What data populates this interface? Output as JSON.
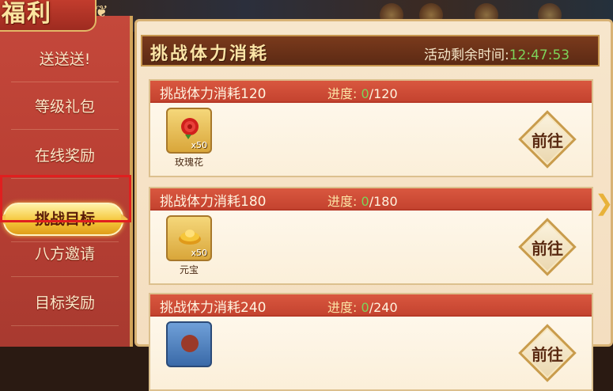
{
  "panel_title": "福利",
  "sidebar": {
    "items": [
      {
        "label": "送送送!"
      },
      {
        "label": "等级礼包"
      },
      {
        "label": "在线奖励"
      },
      {
        "label": "挑战目标",
        "active": true
      },
      {
        "label": "八方邀请"
      },
      {
        "label": "目标奖励"
      }
    ]
  },
  "header": {
    "title": "挑战体力消耗",
    "timer_label": "活动剩余时间:",
    "timer_value": "12:47:53"
  },
  "cards": [
    {
      "title": "挑战体力消耗120",
      "progress_label": "进度:",
      "progress_current": "0",
      "progress_total": "/120",
      "reward_name": "玫瑰花",
      "reward_qty": "x50",
      "reward_icon": "rose-icon",
      "go_label": "前往"
    },
    {
      "title": "挑战体力消耗180",
      "progress_label": "进度:",
      "progress_current": "0",
      "progress_total": "/180",
      "reward_name": "元宝",
      "reward_qty": "x50",
      "reward_icon": "gold-ingot-icon",
      "go_label": "前往"
    },
    {
      "title": "挑战体力消耗240",
      "progress_label": "进度:",
      "progress_current": "0",
      "progress_total": "/240",
      "reward_icon": "item-icon",
      "go_label": "前往"
    }
  ],
  "colors": {
    "sidebar_red": "#c4483b",
    "active_gold": "#f5c73a",
    "card_head_red": "#d9573f",
    "progress_green": "#7dd35a",
    "highlight_red": "#e01f1f"
  }
}
